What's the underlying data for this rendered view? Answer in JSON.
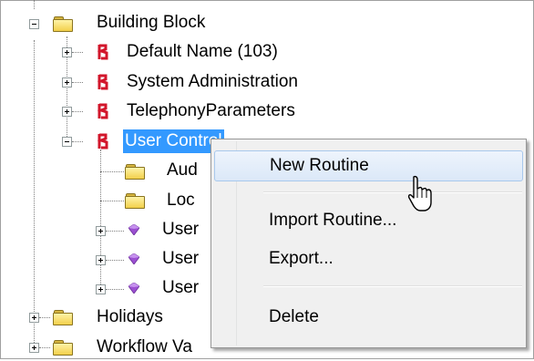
{
  "tree": {
    "building_block": "Building Block",
    "default_name": "Default Name (103)",
    "system_administration": "System Administration",
    "telephony_parameters": "TelephonyParameters",
    "user_control": "User Control",
    "aud_partial": "Aud",
    "loc_partial": "Loc",
    "user_partial_1": "User",
    "user_partial_2": "User",
    "user_partial_3": "User",
    "holidays": "Holidays",
    "workflow_partial": "Workflow Va"
  },
  "context_menu": {
    "new_routine": "New Routine",
    "import_routine": "Import Routine...",
    "export": "Export...",
    "delete": "Delete"
  },
  "icons": {
    "folder": "folder-icon",
    "hook": "red-hook-icon",
    "gem": "purple-gem-icon",
    "expander": "expander-icon",
    "cursor": "mouse-cursor-icon"
  },
  "colors": {
    "selection": "#3399ff",
    "folder": "#f2cf4a",
    "hook": "#d2162b",
    "gem": "#9b4fd1",
    "menu_bg": "#f0f0f0",
    "menu_hot": "#dbe8f8"
  }
}
